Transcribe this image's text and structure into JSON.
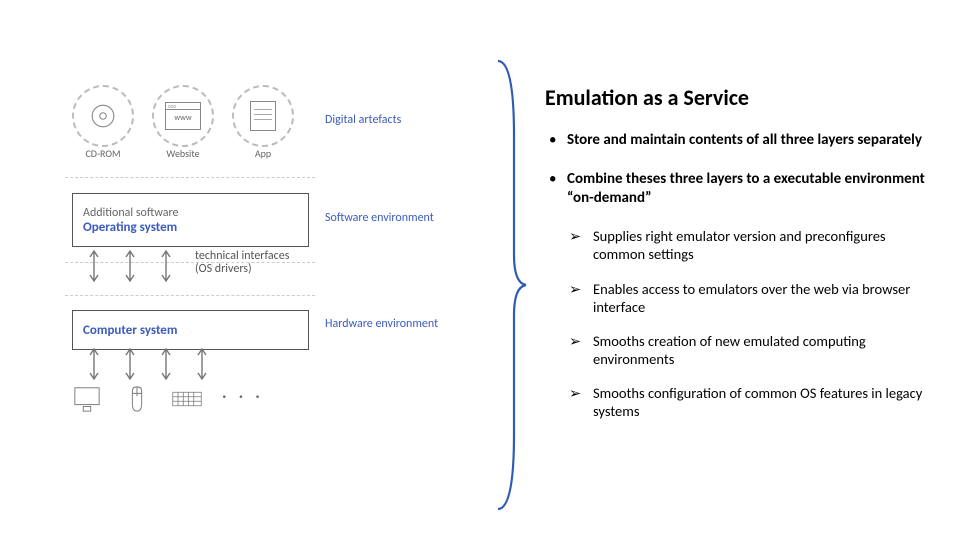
{
  "slide": {
    "title": "Emulation as a Service",
    "bullets": [
      "Store and maintain contents of all three layers separately",
      "Combine theses three layers to a executable environment “on-demand”"
    ],
    "subbullets": [
      "Supplies right emulator version and preconfigures common settings",
      "Enables access to emulators over the web via browser interface",
      "Smooths creation of new emulated computing environments",
      "Smooths configuration of common OS features in legacy systems"
    ]
  },
  "diagram": {
    "artefacts_label": "Digital artefacts",
    "artefacts": {
      "a0": "CD-ROM",
      "a1": "Website",
      "a2": "App"
    },
    "artefact_window_caption": "www",
    "sw_box_line1": "Additional software",
    "sw_box_line2": "Operating system",
    "sw_env_label": "Software environment",
    "interfaces_label_l1": "technical interfaces",
    "interfaces_label_l2": "(OS drivers)",
    "hw_box": "Computer system",
    "hw_env_label": "Hardware environment",
    "hw_ellipsis": "· · ·"
  }
}
